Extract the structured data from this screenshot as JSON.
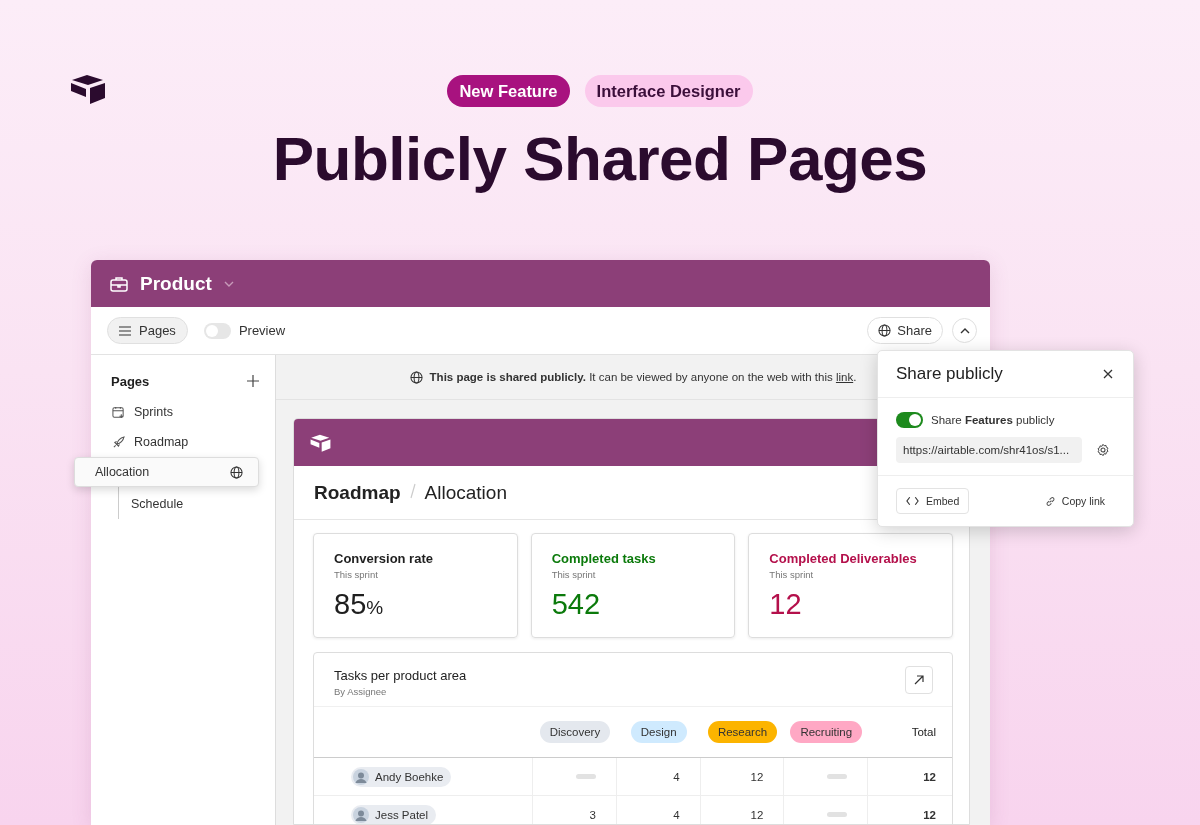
{
  "tags": [
    {
      "label": "New Feature",
      "kind": "primary"
    },
    {
      "label": "Interface Designer",
      "kind": "secondary"
    }
  ],
  "headline": "Publicly Shared Pages",
  "window": {
    "title": "Product"
  },
  "toolbar": {
    "pages_button": "Pages",
    "preview": {
      "label": "Preview",
      "on": false
    },
    "share_button": "Share"
  },
  "sidebar": {
    "title": "Pages",
    "items": [
      {
        "label": "Sprints"
      },
      {
        "label": "Roadmap",
        "children": [
          {
            "label": "Allocation",
            "dragging": true
          },
          {
            "label": "Schedule",
            "dragging": false
          }
        ]
      }
    ]
  },
  "banner": {
    "text": "**This page is shared publicly.** It can be viewed by anyone on the web with this",
    "link": "link",
    "end": "."
  },
  "page": {
    "breadcrumb": [
      "Roadmap",
      "Allocation"
    ],
    "stats": [
      {
        "title": "Conversion rate",
        "subtitle": "This sprint",
        "value": "85",
        "unit": "%",
        "color": "#1f1f1f"
      },
      {
        "title": "Completed tasks",
        "subtitle": "This sprint",
        "value": "542",
        "color": "#0b7a0b"
      },
      {
        "title": "Completed Deliverables",
        "subtitle": "This sprint",
        "value": "12",
        "color": "#b4104b"
      }
    ],
    "table": {
      "title": "Tasks per product area",
      "subtitle": "By Assignee",
      "columns": [
        {
          "label": "Discovery",
          "color": "#e4e8ee"
        },
        {
          "label": "Design",
          "color": "#cfeafe"
        },
        {
          "label": "Research",
          "color": "#fcb400"
        },
        {
          "label": "Recruiting",
          "color": "#ffa8c4"
        }
      ],
      "total_label": "Total",
      "rows": [
        {
          "name": "Andy Boehke",
          "cells": [
            null,
            "4",
            "12",
            null
          ],
          "total": "12"
        },
        {
          "name": "Jess Patel",
          "cells": [
            "3",
            "4",
            "12",
            null
          ],
          "total": "12"
        }
      ]
    }
  },
  "share_popover": {
    "title": "Share publicly",
    "toggle": {
      "on": true,
      "text": "Share **Features** publicly"
    },
    "url": "https://airtable.com/shr41os/s1...",
    "embed": "Embed",
    "copy": "Copy link"
  }
}
